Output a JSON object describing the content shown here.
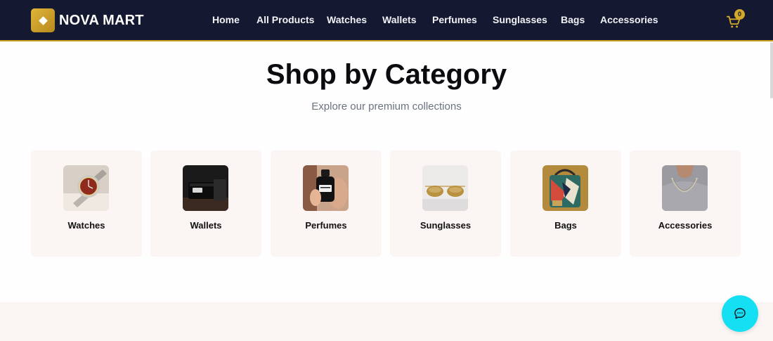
{
  "brand": {
    "name": "NOVA MART",
    "logo_icon": "diamond-icon",
    "accent": "#c9a227"
  },
  "nav": {
    "items": [
      {
        "label": "Home"
      },
      {
        "label": "All Products"
      },
      {
        "label": "Watches"
      },
      {
        "label": "Wallets"
      },
      {
        "label": "Perfumes"
      },
      {
        "label": "Sunglasses"
      },
      {
        "label": "Bags"
      },
      {
        "label": "Accessories"
      }
    ]
  },
  "cart": {
    "icon": "cart-icon",
    "count": "0"
  },
  "section": {
    "title": "Shop by Category",
    "subtitle": "Explore our premium collections"
  },
  "categories": [
    {
      "label": "Watches",
      "image": "watch-photo"
    },
    {
      "label": "Wallets",
      "image": "wallet-photo"
    },
    {
      "label": "Perfumes",
      "image": "perfume-photo"
    },
    {
      "label": "Sunglasses",
      "image": "sunglasses-photo"
    },
    {
      "label": "Bags",
      "image": "bag-photo"
    },
    {
      "label": "Accessories",
      "image": "chain-necklace-photo"
    }
  ],
  "chat": {
    "icon": "chat-bubble-icon",
    "color": "#15e0f3"
  }
}
